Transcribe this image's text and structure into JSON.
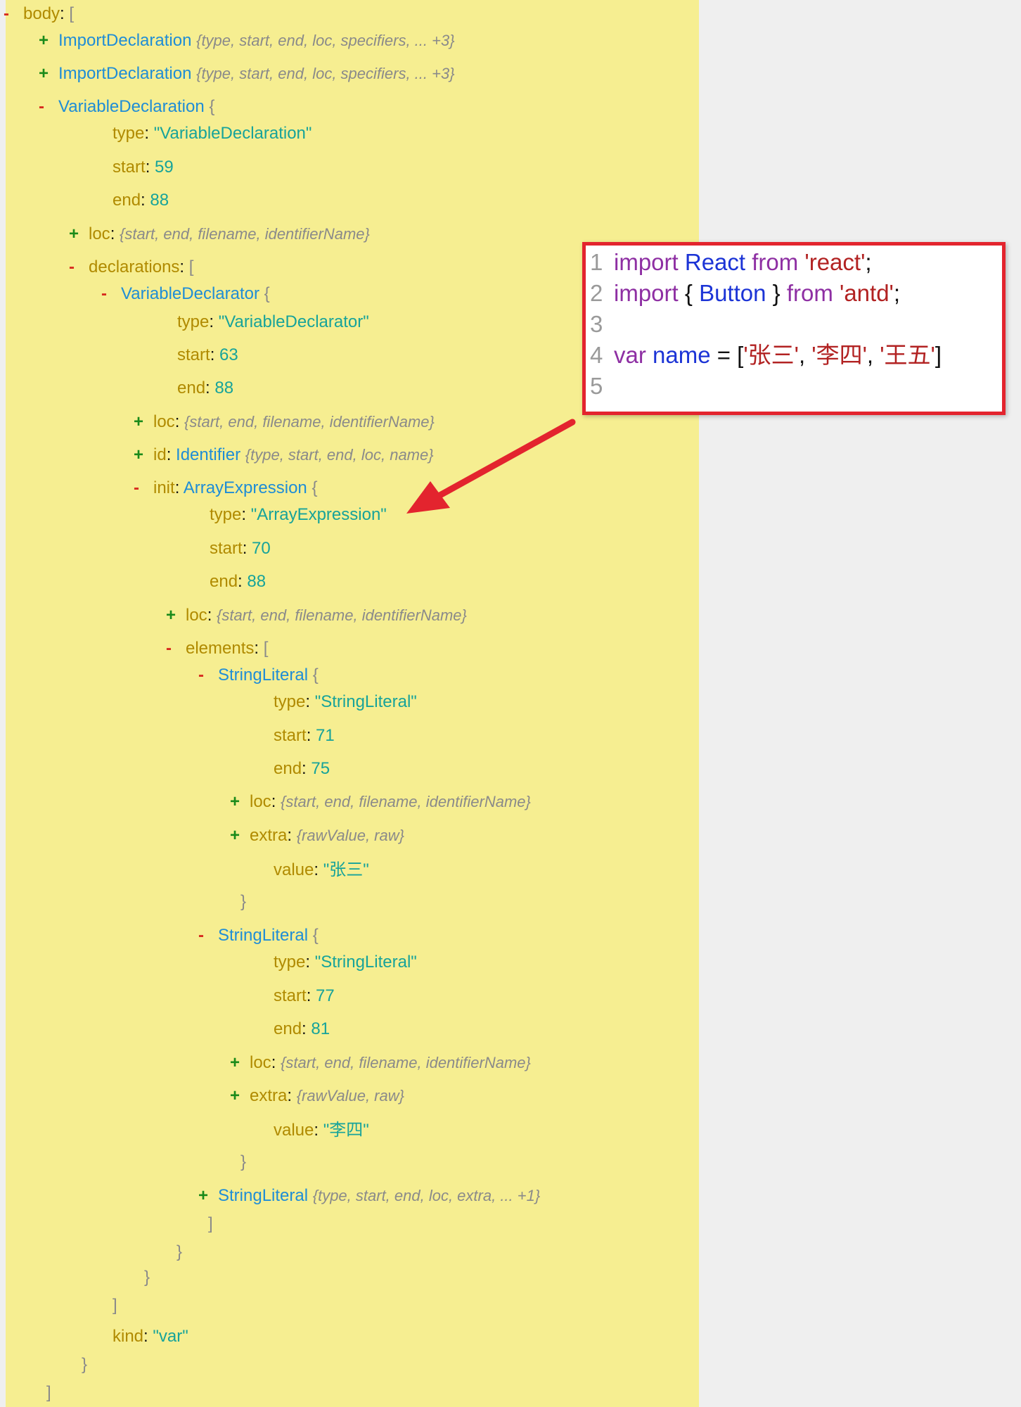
{
  "rows": [
    {
      "tog": "-",
      "parts": [
        [
          "key",
          "body"
        ],
        [
          "pn",
          ": "
        ],
        [
          "br",
          "["
        ]
      ]
    },
    {
      "tog": "+",
      "parts": [
        [
          "type",
          "ImportDeclaration"
        ],
        [
          "pn",
          " "
        ],
        [
          "summary",
          "{type, start, end, loc, specifiers, ... +3}"
        ]
      ]
    },
    {
      "tog": "+",
      "parts": [
        [
          "type",
          "ImportDeclaration"
        ],
        [
          "pn",
          " "
        ],
        [
          "summary",
          "{type, start, end, loc, specifiers, ... +3}"
        ]
      ]
    },
    {
      "tog": "-",
      "parts": [
        [
          "type",
          "VariableDeclaration"
        ],
        [
          "pn",
          "  "
        ],
        [
          "br",
          "{"
        ]
      ]
    },
    {
      "tog": "",
      "parts": [
        [
          "key",
          "type"
        ],
        [
          "pn",
          ": "
        ],
        [
          "str",
          "\"VariableDeclaration\""
        ]
      ]
    },
    {
      "tog": "",
      "parts": [
        [
          "key",
          "start"
        ],
        [
          "pn",
          ": "
        ],
        [
          "num",
          "59"
        ]
      ]
    },
    {
      "tog": "",
      "parts": [
        [
          "key",
          "end"
        ],
        [
          "pn",
          ": "
        ],
        [
          "num",
          "88"
        ]
      ]
    },
    {
      "tog": "+",
      "parts": [
        [
          "key",
          "loc"
        ],
        [
          "pn",
          ": "
        ],
        [
          "summary",
          "{start, end, filename, identifierName}"
        ]
      ]
    },
    {
      "tog": "-",
      "parts": [
        [
          "key",
          "declarations"
        ],
        [
          "pn",
          ":  "
        ],
        [
          "br",
          "["
        ]
      ]
    },
    {
      "tog": "-",
      "parts": [
        [
          "type",
          "VariableDeclarator"
        ],
        [
          "pn",
          "  "
        ],
        [
          "br",
          "{"
        ]
      ]
    },
    {
      "tog": "",
      "parts": [
        [
          "key",
          "type"
        ],
        [
          "pn",
          ": "
        ],
        [
          "str",
          "\"VariableDeclarator\""
        ]
      ]
    },
    {
      "tog": "",
      "parts": [
        [
          "key",
          "start"
        ],
        [
          "pn",
          ": "
        ],
        [
          "num",
          "63"
        ]
      ]
    },
    {
      "tog": "",
      "parts": [
        [
          "key",
          "end"
        ],
        [
          "pn",
          ": "
        ],
        [
          "num",
          "88"
        ]
      ]
    },
    {
      "tog": "+",
      "parts": [
        [
          "key",
          "loc"
        ],
        [
          "pn",
          ": "
        ],
        [
          "summary",
          "{start, end, filename, identifierName}"
        ]
      ]
    },
    {
      "tog": "+",
      "parts": [
        [
          "key",
          "id"
        ],
        [
          "pn",
          ": "
        ],
        [
          "type",
          "Identifier"
        ],
        [
          "pn",
          " "
        ],
        [
          "summary",
          "{type, start, end, loc, name}"
        ]
      ]
    },
    {
      "tog": "-",
      "parts": [
        [
          "key",
          "init"
        ],
        [
          "pn",
          ": "
        ],
        [
          "type",
          "ArrayExpression"
        ],
        [
          "pn",
          "  "
        ],
        [
          "br",
          "{"
        ]
      ]
    },
    {
      "tog": "",
      "parts": [
        [
          "key",
          "type"
        ],
        [
          "pn",
          ": "
        ],
        [
          "str",
          "\"ArrayExpression\""
        ]
      ]
    },
    {
      "tog": "",
      "parts": [
        [
          "key",
          "start"
        ],
        [
          "pn",
          ": "
        ],
        [
          "num",
          "70"
        ]
      ]
    },
    {
      "tog": "",
      "parts": [
        [
          "key",
          "end"
        ],
        [
          "pn",
          ": "
        ],
        [
          "num",
          "88"
        ]
      ]
    },
    {
      "tog": "+",
      "parts": [
        [
          "key",
          "loc"
        ],
        [
          "pn",
          ": "
        ],
        [
          "summary",
          "{start, end, filename, identifierName}"
        ]
      ]
    },
    {
      "tog": "-",
      "parts": [
        [
          "key",
          "elements"
        ],
        [
          "pn",
          ":  "
        ],
        [
          "br",
          "["
        ]
      ]
    },
    {
      "tog": "-",
      "parts": [
        [
          "type",
          "StringLiteral"
        ],
        [
          "pn",
          "  "
        ],
        [
          "br",
          "{"
        ]
      ]
    },
    {
      "tog": "",
      "parts": [
        [
          "key",
          "type"
        ],
        [
          "pn",
          ": "
        ],
        [
          "str",
          "\"StringLiteral\""
        ]
      ]
    },
    {
      "tog": "",
      "parts": [
        [
          "key",
          "start"
        ],
        [
          "pn",
          ": "
        ],
        [
          "num",
          "71"
        ]
      ]
    },
    {
      "tog": "",
      "parts": [
        [
          "key",
          "end"
        ],
        [
          "pn",
          ": "
        ],
        [
          "num",
          "75"
        ]
      ]
    },
    {
      "tog": "+",
      "parts": [
        [
          "key",
          "loc"
        ],
        [
          "pn",
          ": "
        ],
        [
          "summary",
          "{start, end, filename, identifierName}"
        ]
      ]
    },
    {
      "tog": "+",
      "parts": [
        [
          "key",
          "extra"
        ],
        [
          "pn",
          ": "
        ],
        [
          "summary",
          "{rawValue, raw}"
        ]
      ]
    },
    {
      "tog": "",
      "parts": [
        [
          "key",
          "value"
        ],
        [
          "pn",
          ": "
        ],
        [
          "str",
          "\"张三\""
        ]
      ]
    },
    {
      "tog": "",
      "parts": [
        [
          "br",
          "}"
        ]
      ]
    },
    {
      "tog": "-",
      "parts": [
        [
          "type",
          "StringLiteral"
        ],
        [
          "pn",
          "  "
        ],
        [
          "br",
          "{"
        ]
      ]
    },
    {
      "tog": "",
      "parts": [
        [
          "key",
          "type"
        ],
        [
          "pn",
          ": "
        ],
        [
          "str",
          "\"StringLiteral\""
        ]
      ]
    },
    {
      "tog": "",
      "parts": [
        [
          "key",
          "start"
        ],
        [
          "pn",
          ": "
        ],
        [
          "num",
          "77"
        ]
      ]
    },
    {
      "tog": "",
      "parts": [
        [
          "key",
          "end"
        ],
        [
          "pn",
          ": "
        ],
        [
          "num",
          "81"
        ]
      ]
    },
    {
      "tog": "+",
      "parts": [
        [
          "key",
          "loc"
        ],
        [
          "pn",
          ": "
        ],
        [
          "summary",
          "{start, end, filename, identifierName}"
        ]
      ]
    },
    {
      "tog": "+",
      "parts": [
        [
          "key",
          "extra"
        ],
        [
          "pn",
          ": "
        ],
        [
          "summary",
          "{rawValue, raw}"
        ]
      ]
    },
    {
      "tog": "",
      "parts": [
        [
          "key",
          "value"
        ],
        [
          "pn",
          ": "
        ],
        [
          "str",
          "\"李四\""
        ]
      ]
    },
    {
      "tog": "",
      "parts": [
        [
          "br",
          "}"
        ]
      ]
    },
    {
      "tog": "+",
      "parts": [
        [
          "type",
          "StringLiteral"
        ],
        [
          "pn",
          " "
        ],
        [
          "summary",
          "{type, start, end, loc, extra, ... +1}"
        ]
      ]
    },
    {
      "tog": "",
      "parts": [
        [
          "br",
          "]"
        ]
      ]
    },
    {
      "tog": "",
      "parts": [
        [
          "br",
          "}"
        ]
      ]
    },
    {
      "tog": "",
      "parts": [
        [
          "br",
          "}"
        ]
      ]
    },
    {
      "tog": "",
      "parts": [
        [
          "br",
          "]"
        ]
      ]
    },
    {
      "tog": "",
      "parts": [
        [
          "key",
          "kind"
        ],
        [
          "pn",
          ": "
        ],
        [
          "str",
          "\"var\""
        ]
      ]
    },
    {
      "tog": "",
      "parts": [
        [
          "br",
          "}"
        ]
      ]
    },
    {
      "tog": "",
      "parts": [
        [
          "br",
          "]"
        ]
      ]
    }
  ],
  "code": {
    "lines": [
      {
        "num": "1",
        "tokens": [
          [
            "kw",
            "import "
          ],
          [
            "id",
            "React "
          ],
          [
            "kw",
            "from "
          ],
          [
            "cs",
            "'react'"
          ],
          [
            "pn",
            ";"
          ]
        ]
      },
      {
        "num": "2",
        "tokens": [
          [
            "kw",
            "import "
          ],
          [
            "pn",
            "{ "
          ],
          [
            "id",
            "Button "
          ],
          [
            "pn",
            "} "
          ],
          [
            "kw",
            "from "
          ],
          [
            "cs",
            "'antd'"
          ],
          [
            "pn",
            ";"
          ]
        ]
      },
      {
        "num": "3",
        "tokens": []
      },
      {
        "num": "4",
        "tokens": [
          [
            "kw",
            "var "
          ],
          [
            "id",
            "name "
          ],
          [
            "pn",
            "= ["
          ],
          [
            "cs",
            "'张三'"
          ],
          [
            "pn",
            ", "
          ],
          [
            "cs",
            "'李四'"
          ],
          [
            "pn",
            ", "
          ],
          [
            "cs",
            "'王五'"
          ],
          [
            "pn",
            "]"
          ]
        ]
      },
      {
        "num": "5",
        "tokens": []
      }
    ]
  },
  "colors": {
    "tree_bg": "#f6ee91",
    "highlight_border": "#e3242e",
    "arrow": "#e3242e"
  }
}
